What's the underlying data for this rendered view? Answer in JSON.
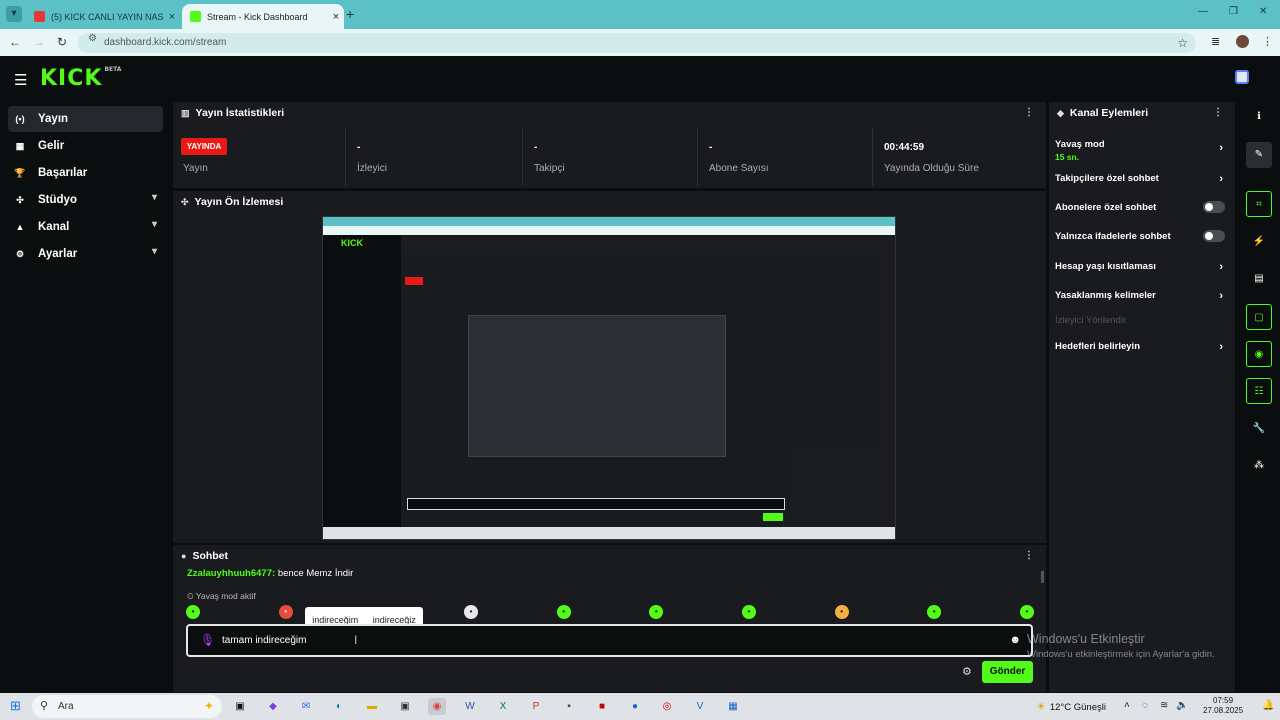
{
  "browser": {
    "tabs": [
      {
        "title": "(5) KICK CANLI YAYIN NASIL YA..."
      },
      {
        "title": "Stream - Kick Dashboard"
      }
    ],
    "url": "dashboard.kick.com/stream"
  },
  "header": {
    "logo": "KICK",
    "beta": "BETA"
  },
  "nav": {
    "items": [
      {
        "label": "Yayın"
      },
      {
        "label": "Gelir"
      },
      {
        "label": "Başarılar"
      },
      {
        "label": "Stüdyo"
      },
      {
        "label": "Kanal"
      },
      {
        "label": "Ayarlar"
      }
    ]
  },
  "stats": {
    "title": "Yayın İstatistikleri",
    "live_badge": "YAYINDA",
    "cells": [
      {
        "label": "Yayın"
      },
      {
        "value": "-",
        "label": "İzleyici"
      },
      {
        "value": "-",
        "label": "Takipçi"
      },
      {
        "value": "-",
        "label": "Abone Sayısı"
      },
      {
        "value": "00:44:59",
        "label": "Yayında Olduğu Süre"
      }
    ]
  },
  "preview": {
    "title": "Yayın Ön İzlemesi"
  },
  "chat": {
    "title": "Sohbet",
    "message": {
      "user": "Zzalauyhhuuh6477:",
      "text": "bence Memz İndir"
    },
    "slow_mode_notice": "Yavaş mod aktif",
    "suggestions": [
      "indireceğim",
      "indireceğiz"
    ],
    "input_value": "tamam indireceğim",
    "send_label": "Gönder"
  },
  "watermark": {
    "line1": "Windows'u Etkinleştir",
    "line2": "Windows'u etkinleştirmek için Ayarlar'a gidin."
  },
  "channel_actions": {
    "title": "Kanal Eylemleri",
    "slow_mode": {
      "label": "Yavaş mod",
      "value": "15 sn."
    },
    "items": [
      {
        "label": "Takipçilere özel sohbet"
      },
      {
        "label": "Abonelere özel sohbet"
      },
      {
        "label": "Yalnızca ifadelerle sohbet"
      },
      {
        "label": "Hesap yaşı kısıtlaması"
      },
      {
        "label": "Yasaklanmış kelimeler"
      },
      {
        "label": "İzleyici Yönlendir"
      },
      {
        "label": "Hedefleri belirleyin"
      }
    ]
  },
  "taskbar": {
    "search_label": "Ara",
    "weather": "12°C Güneşli",
    "time": "07:59",
    "date": "27.08.2025"
  },
  "colors": {
    "brand": "#53fc18",
    "live": "#e91916",
    "panel": "#191b1f",
    "background": "#0b0e0f"
  }
}
